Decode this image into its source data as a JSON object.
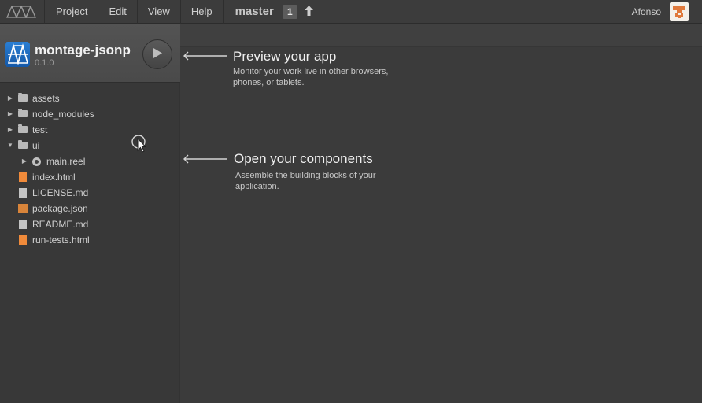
{
  "menubar": {
    "logo_icon": "montage-logo-icon",
    "items": [
      "Project",
      "Edit",
      "View",
      "Help"
    ],
    "branch": "master",
    "commits_badge": "1",
    "push_icon": "push-arrow-up-icon",
    "user": "Afonso",
    "avatar_icon": "pixel-avatar-icon"
  },
  "project": {
    "name": "montage-jsonp",
    "version": "0.1.0",
    "icon": "montage-project-icon",
    "play_icon": "play-icon"
  },
  "tree": {
    "items": [
      {
        "name": "assets",
        "type": "folder",
        "expanded": false
      },
      {
        "name": "node_modules",
        "type": "folder",
        "expanded": false
      },
      {
        "name": "test",
        "type": "folder",
        "expanded": false
      },
      {
        "name": "ui",
        "type": "folder",
        "expanded": true
      },
      {
        "name": "main.reel",
        "type": "component",
        "expanded": false
      },
      {
        "name": "index.html",
        "type": "html-file"
      },
      {
        "name": "LICENSE.md",
        "type": "text-file"
      },
      {
        "name": "package.json",
        "type": "json-file"
      },
      {
        "name": "README.md",
        "type": "text-file"
      },
      {
        "name": "run-tests.html",
        "type": "html-file"
      }
    ]
  },
  "hints": {
    "preview": {
      "title": "Preview your app",
      "description": "Monitor your work live in other browsers, phones, or tablets."
    },
    "components": {
      "title": "Open your components",
      "description": "Assemble the building blocks of your application."
    },
    "arrow": "⟵———"
  },
  "colors": {
    "background": "#3a3a3a",
    "menubar": "#3c3c3c",
    "project_panel": "#4e4e4e",
    "html_file": "#f08a3a",
    "folder": "#b9b9b9"
  }
}
